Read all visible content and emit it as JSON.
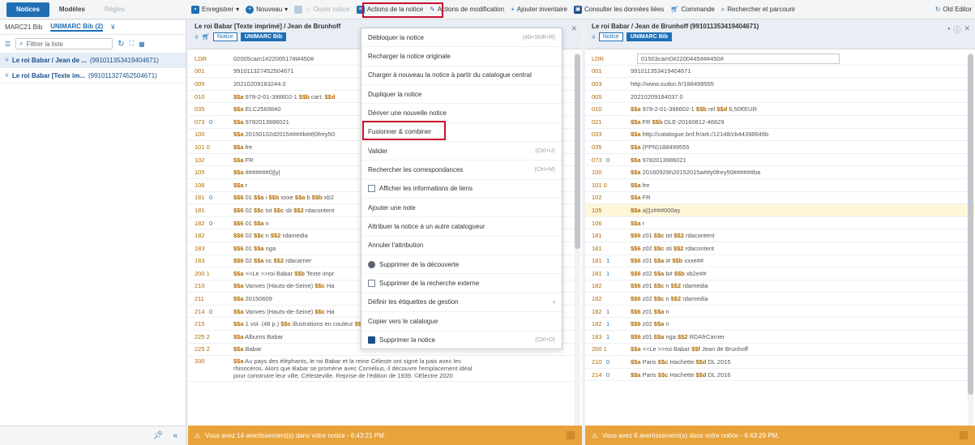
{
  "tabs": [
    {
      "label": "Notices",
      "state": "active"
    },
    {
      "label": "Modèles",
      "state": "normal"
    },
    {
      "label": "Règles",
      "state": "disabled"
    }
  ],
  "toolbar": {
    "save": "Enregistrer",
    "new": "Nouveau",
    "open": "Ouvrir notice",
    "record_actions": "Actions de la notice",
    "edit_actions": "Actions de modification",
    "add_inventory": "Ajouter inventaire",
    "linked_data": "Consulter les données liées",
    "order": "Commande",
    "search_browse": "Rechercher et parcourir",
    "old_editor": "Old Editor"
  },
  "left": {
    "tab1": "MARC21 Bib",
    "tab2": "UNIMARC Bib (2)",
    "filter_placeholder": "Filtrer la liste",
    "items": [
      {
        "title": "Le roi Babar / Jean de ...",
        "num": "(991011353419404671)"
      },
      {
        "title": "Le roi Babar [Texte im...",
        "num": "(991011327452504671)"
      }
    ]
  },
  "panel1": {
    "title": "Le roi Babar [Texte imprimé] / Jean de Brunhoff",
    "tag_notice": "Notice",
    "tag_format": "UNIMARC Bib",
    "warning": "Vous avez 14 avertissement(s) dans votre notice - 6:43:21 PM.",
    "rows": [
      {
        "tag": "LDR",
        "ind": "",
        "val": "02005cam1#2200517#i#450#"
      },
      {
        "tag": "001",
        "ind": "",
        "val": "991011327452504671"
      },
      {
        "tag": "005",
        "ind": "",
        "val": "20210209183244.0"
      },
      {
        "tag": "010",
        "ind": "",
        "val": "$$a 978-2-01-398602-1 $$b cart. $$d"
      },
      {
        "tag": "035",
        "ind": "",
        "val": "$$a ELC2569840"
      },
      {
        "tag": "073",
        "ind": "0",
        "val": "$$a 9782013986021"
      },
      {
        "tag": "100",
        "ind": "",
        "val": "$$a 20150102d2015####b##|0frey50"
      },
      {
        "tag": "101 0",
        "ind": "",
        "val": "$$a fre"
      },
      {
        "tag": "102",
        "ind": "",
        "val": "$$a FR"
      },
      {
        "tag": "105",
        "ind": "",
        "val": "$$a #######0||y|"
      },
      {
        "tag": "106",
        "ind": "",
        "val": "$$a r"
      },
      {
        "tag": "181",
        "ind": "0",
        "val": "$$6 01 $$a i $$b xxxe $$a b $$b xb2"
      },
      {
        "tag": "181",
        "ind": "",
        "val": "$$6 02 $$c txt $$c sb $$2 rdacontent"
      },
      {
        "tag": "182",
        "ind": "0",
        "val": "$$6 01 $$a n"
      },
      {
        "tag": "182",
        "ind": "",
        "val": "$$6 02 $$c n $$2 rdamedia"
      },
      {
        "tag": "183",
        "ind": "",
        "val": "$$6 01 $$a nga"
      },
      {
        "tag": "183",
        "ind": "",
        "val": "$$6 02 $$a nc $$2 rdacarrier"
      },
      {
        "tag": "200 1",
        "ind": "",
        "val": "$$a <<Le >>roi Babar $$b Texte impr"
      },
      {
        "tag": "210",
        "ind": "",
        "val": "$$a Vanves (Hauts-de-Seine) $$c Ha"
      },
      {
        "tag": "211",
        "ind": "",
        "val": "$$a 20150609"
      },
      {
        "tag": "214",
        "ind": "0",
        "val": "$$a Vanves (Hauts-de-Seine) $$c Ha"
      },
      {
        "tag": "215",
        "ind": "",
        "val": "$$a 1 vol. (48 p.) $$c illustrations en couleur $$d 20 x 19 cm"
      },
      {
        "tag": "225 2",
        "ind": "",
        "val": "$$a Albums Babar"
      },
      {
        "tag": "225 2",
        "ind": "",
        "val": "$$a Babar"
      },
      {
        "tag": "330",
        "ind": "",
        "val": "$$a Au pays des éléphants, le roi Babar et la reine Céleste ont signé la paix avec les rhinocéros. Alors que Babar se promène avec Cornélius, il découvre l'emplacement idéal pour construire leur ville, Célesteville. Reprise de l'édition de 1939. ©Electre 2020"
      }
    ]
  },
  "panel2": {
    "title": "Le roi Babar / Jean de Brunhoff",
    "title_num": "(991011353419404671)",
    "tag_notice": "Notice",
    "tag_format": "UNIMARC Bib",
    "warning": "Vous avez 6 avertissement(s) dans votre notice - 6:43:29 PM.",
    "rows": [
      {
        "tag": "LDR",
        "ind": "",
        "val": "01503cam0#2200445###450#"
      },
      {
        "tag": "001",
        "ind": "",
        "val": "991011353419404671"
      },
      {
        "tag": "003",
        "ind": "",
        "val": "http://www.sudoc.fr/188499555"
      },
      {
        "tag": "005",
        "ind": "",
        "val": "20210209184037.0"
      },
      {
        "tag": "010",
        "ind": "",
        "val": "$$a 978-2-01-398602-1 $$b rel $$d 6,50€EUR"
      },
      {
        "tag": "021",
        "ind": "",
        "val": "$$a FR $$b DLE-20160812-46629"
      },
      {
        "tag": "033",
        "ind": "",
        "val": "$$a http://catalogue.bnf.fr/ark:/12148/cb44398649b"
      },
      {
        "tag": "035",
        "ind": "",
        "val": "$$a (PPN)188499555"
      },
      {
        "tag": "073",
        "ind": "0",
        "val": "$$a 9782013986021"
      },
      {
        "tag": "100",
        "ind": "",
        "val": "$$a 20160929h20152015a##y0frey50######ba"
      },
      {
        "tag": "101 0",
        "ind": "",
        "val": "$$a fre"
      },
      {
        "tag": "102",
        "ind": "",
        "val": "$$a FR"
      },
      {
        "tag": "105",
        "ind": "",
        "val": "$$a a|||z###000ay"
      },
      {
        "tag": "106",
        "ind": "",
        "val": "$$a r"
      },
      {
        "tag": "181",
        "ind": "",
        "val": "$$6 z01 $$c txt $$2 rdacontent"
      },
      {
        "tag": "181",
        "ind": "",
        "val": "$$6 z02 $$c sti $$2 rdacontent"
      },
      {
        "tag": "181",
        "ind": "1",
        "val": "$$6 z01 $$a i# $$b xxxe##"
      },
      {
        "tag": "181",
        "ind": "1",
        "val": "$$6 z02 $$a b# $$b xb2e##"
      },
      {
        "tag": "182",
        "ind": "",
        "val": "$$6 z01 $$c n $$2 rdamedia"
      },
      {
        "tag": "182",
        "ind": "",
        "val": "$$6 z02 $$c n $$2 rdamedia"
      },
      {
        "tag": "182",
        "ind": "1",
        "val": "$$6 z01 $$a n"
      },
      {
        "tag": "182",
        "ind": "1",
        "val": "$$6 z02 $$a n"
      },
      {
        "tag": "183",
        "ind": "1",
        "val": "$$6 z01 $$a nga $$2 RDAfrCarrier"
      },
      {
        "tag": "200 1",
        "ind": "",
        "val": "$$a <<Le >>roi Babar $$f Jean de Brunhoff"
      },
      {
        "tag": "210",
        "ind": "0",
        "val": "$$a Paris $$c Hachette $$d DL 2015"
      },
      {
        "tag": "214",
        "ind": "0",
        "val": "$$a Paris $$c Hachette $$d DL 2016"
      }
    ]
  },
  "menu": {
    "items": [
      {
        "label": "Débloquer la notice",
        "shortcut": "(Alt+Shift+R)"
      },
      {
        "label": "Recharger la notice originale"
      },
      {
        "label": "Charger à nouveau la notice à partir du catalogue central"
      },
      {
        "label": "Dupliquer la notice"
      },
      {
        "label": "Dériver une nouvelle notice"
      },
      {
        "label": "Fusionner & combiner",
        "highlighted": true
      },
      {
        "label": "Valider",
        "shortcut": "(Ctrl+U)"
      },
      {
        "label": "Rechercher les correspondances",
        "shortcut": "(Ctrl+M)"
      },
      {
        "label": "Afficher les informations de liens",
        "checkbox": true
      },
      {
        "label": "Ajouter une note"
      },
      {
        "label": "Attribuer la notice à un autre catalogueur"
      },
      {
        "label": "Annuler l'attribution"
      },
      {
        "label": "Supprimer de la découverte",
        "icon": "eye-off-icon"
      },
      {
        "label": "Supprimer de la recherche externe",
        "checkbox": true
      },
      {
        "label": "Définir les étiquettes de gestion",
        "submenu": true
      },
      {
        "label": "Copier vers le catalogue"
      },
      {
        "label": "Supprimer la notice",
        "shortcut": "(Ctrl+D)",
        "icon": "trash-icon"
      }
    ]
  },
  "colors": {
    "accent": "#1f6fb5",
    "highlight": "#c8102e",
    "warning": "#e8a33b"
  }
}
